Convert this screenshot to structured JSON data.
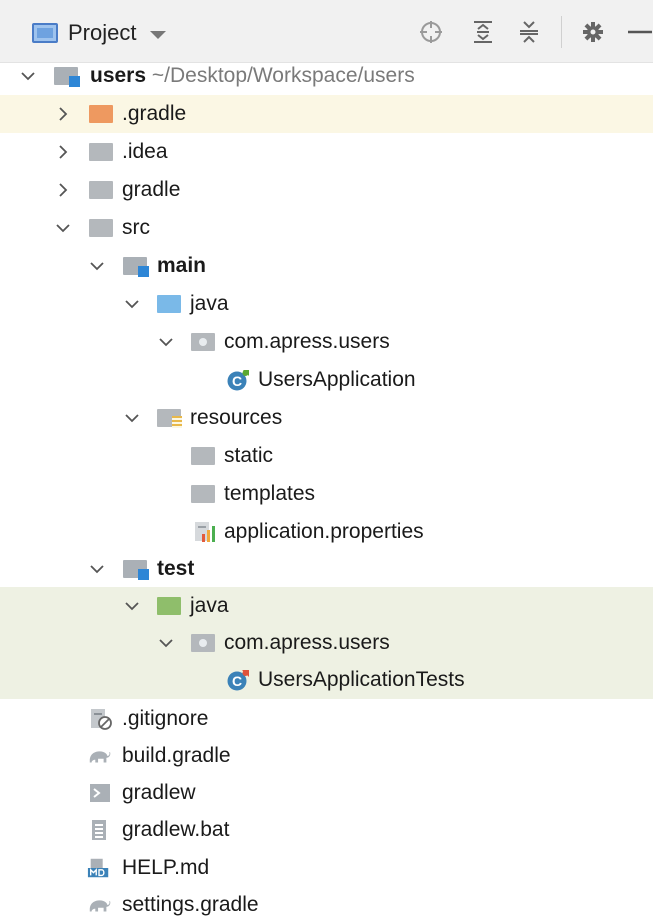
{
  "toolbar": {
    "title": "Project",
    "buttons": [
      "locate-icon",
      "expand-all-icon",
      "collapse-all-icon",
      "gear-icon",
      "minimize-icon"
    ]
  },
  "tree": {
    "root": {
      "name": "users",
      "path": "~/Desktop/Workspace/users"
    },
    "items": [
      {
        "label": ".gradle"
      },
      {
        "label": ".idea"
      },
      {
        "label": "gradle"
      },
      {
        "label": "src"
      },
      {
        "label": "main"
      },
      {
        "label": "java"
      },
      {
        "label": "com.apress.users"
      },
      {
        "label": "UsersApplication"
      },
      {
        "label": "resources"
      },
      {
        "label": "static"
      },
      {
        "label": "templates"
      },
      {
        "label": "application.properties"
      },
      {
        "label": "test"
      },
      {
        "label": "java"
      },
      {
        "label": "com.apress.users"
      },
      {
        "label": "UsersApplicationTests"
      },
      {
        "label": ".gitignore"
      },
      {
        "label": "build.gradle"
      },
      {
        "label": "gradlew"
      },
      {
        "label": "gradlew.bat"
      },
      {
        "label": "HELP.md"
      },
      {
        "label": "settings.gradle"
      }
    ]
  },
  "colors": {
    "selected_row": "#fbf7e4",
    "test_rows": "#eef1e3",
    "module_mark": "#2e86d6",
    "excluded_folder": "#ee9960"
  }
}
